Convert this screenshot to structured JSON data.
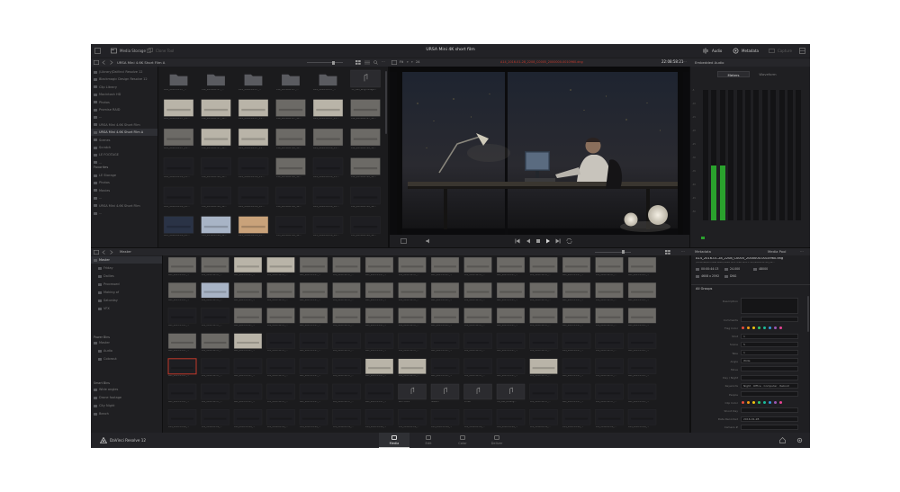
{
  "topbar": {
    "media_storage": "Media Storage",
    "clone_tool": "Clone Tool",
    "project_title": "URSA Mini 4K short film",
    "audio": "Audio",
    "metadata": "Metadata",
    "capture": "Capture"
  },
  "browser": {
    "path": "URSA Mini 4.6K Short Film A",
    "items": [
      {
        "label": "(Library)DaVinci Resolve 12"
      },
      {
        "label": "Blackmagic Design Resolve 12"
      },
      {
        "label": "Clip Library"
      },
      {
        "label": "Macintosh HD"
      },
      {
        "label": "Photos"
      },
      {
        "label": "Promise RAID"
      },
      {
        "label": "..."
      },
      {
        "label": "URSA Mini 4.6K Short Film"
      },
      {
        "label": "URSA Mini 4.6K Short Film A"
      },
      {
        "label": "Scenes"
      },
      {
        "label": "Scratch"
      },
      {
        "label": "LE FOOTAGE"
      },
      {
        "label": "..."
      }
    ],
    "selected_index": 8,
    "favorites_title": "Favorites",
    "favorites": [
      {
        "label": "LE Storage"
      },
      {
        "label": "Photos"
      },
      {
        "label": "Movies"
      },
      {
        "label": "..."
      },
      {
        "label": "URSA Mini 4.6K Short Film"
      },
      {
        "label": "..."
      }
    ]
  },
  "media_grid": {
    "clips": [
      {
        "name": "A14_2016-01-27_...",
        "tone": "folder"
      },
      {
        "name": "A14_2016-01-27_...",
        "tone": "folder"
      },
      {
        "name": "A14_2016-01-27_...",
        "tone": "folder"
      },
      {
        "name": "A14_2016-01-27_...",
        "tone": "folder"
      },
      {
        "name": "A14_2016-01-27_...",
        "tone": "folder"
      },
      {
        "name": "ITA_Cell_ertgminage...",
        "tone": "audio"
      },
      {
        "name": "A14_2016-01-27_11...",
        "tone": "light"
      },
      {
        "name": "A14_2016-01-27_11...",
        "tone": "light"
      },
      {
        "name": "A14_2016-01-27_11...",
        "tone": "light"
      },
      {
        "name": "A14_2016-01-27_11...",
        "tone": "mid"
      },
      {
        "name": "A14_2016-01-27_11...",
        "tone": "light"
      },
      {
        "name": "A14_2016-01-27_11...",
        "tone": "mid"
      },
      {
        "name": "A14_2016-01-27_11...",
        "tone": "mid"
      },
      {
        "name": "A14_2016-01-27_11...",
        "tone": "light"
      },
      {
        "name": "A14_2016-01-27_11...",
        "tone": "light"
      },
      {
        "name": "A14_2016-01-28_11...",
        "tone": "mid"
      },
      {
        "name": "A14_2016-01-28_11...",
        "tone": "mid"
      },
      {
        "name": "A14_2016-01-28_11...",
        "tone": "mid"
      },
      {
        "name": "A14_2016-01-28_11...",
        "tone": "dark"
      },
      {
        "name": "A14_2016-01-28_11...",
        "tone": "dark"
      },
      {
        "name": "A14_2016-01-28_11...",
        "tone": "dark"
      },
      {
        "name": "A14_2016-01-28_11...",
        "tone": "mid"
      },
      {
        "name": "A14_2016-01-28_11...",
        "tone": "dark"
      },
      {
        "name": "A14_2016-01-28_11...",
        "tone": "mid"
      },
      {
        "name": "A14_2016-01-28_12...",
        "tone": "dark"
      },
      {
        "name": "A14_2016-01-28_12...",
        "tone": "dark"
      },
      {
        "name": "A14_2016-01-28_12...",
        "tone": "dark"
      },
      {
        "name": "A14_2016-01-28_12...",
        "tone": "dark"
      },
      {
        "name": "A14_2016-01-28_12...",
        "tone": "dark"
      },
      {
        "name": "A14_2016-01-28_12...",
        "tone": "dark"
      },
      {
        "name": "A15_2016-01-28_12...",
        "tone": "blue"
      },
      {
        "name": "C15_2016-01-28_12...",
        "tone": "sky"
      },
      {
        "name": "C15_2016-01-28_12...",
        "tone": "warm"
      },
      {
        "name": "A15_2016-01-28_12...",
        "tone": "dark"
      },
      {
        "name": "A15_2016-01-28_12...",
        "tone": "dark"
      },
      {
        "name": "A15_2016-01-28_12...",
        "tone": "dark"
      }
    ]
  },
  "viewer": {
    "fit": "Fit",
    "zoom": "24",
    "clip_name": "A14_2016-01-28_2208_C0005_2000000-0010960.dng",
    "timecode": "22:08:58:21"
  },
  "audio_panel": {
    "title": "Embedded Audio",
    "tab_meters": "Meters",
    "tab_waveform": "Waveform",
    "meter_levels": [
      0,
      0.42,
      0.42,
      0,
      0,
      0,
      0,
      0,
      0,
      0,
      0,
      0
    ],
    "scale_labels": [
      "-5",
      "-10",
      "-15",
      "-20",
      "-25",
      "-30",
      "-35",
      "-40",
      "-45",
      "-50"
    ]
  },
  "pool": {
    "title": "Master",
    "bins": [
      {
        "label": "Master",
        "level": 0
      },
      {
        "label": "Friday",
        "level": 1
      },
      {
        "label": "Dailies",
        "level": 1
      },
      {
        "label": "Processed",
        "level": 1
      },
      {
        "label": "Making of",
        "level": 1
      },
      {
        "label": "Saturday",
        "level": 1
      },
      {
        "label": "VFX",
        "level": 1
      }
    ],
    "power_bins_title": "Power Bins",
    "power_bins": [
      {
        "label": "Master",
        "level": 0
      },
      {
        "label": "Audio",
        "level": 1
      },
      {
        "label": "Colorout",
        "level": 1
      }
    ],
    "smart_bins_title": "Smart Bins",
    "smart_bins": [
      {
        "label": "Wide angles"
      },
      {
        "label": "Drone footage"
      },
      {
        "label": "City Night"
      },
      {
        "label": "Beach"
      }
    ],
    "selected_clip": 60,
    "clips": [
      {
        "name": "A01_2015-11-17_...",
        "tone": "mid"
      },
      {
        "name": "A01_2015-11-17_...",
        "tone": "mid"
      },
      {
        "name": "A01_2015-11-17_...",
        "tone": "light"
      },
      {
        "name": "A01_2015-11-17_...",
        "tone": "light"
      },
      {
        "name": "A01_2015-11-17_...",
        "tone": "mid"
      },
      {
        "name": "A01_2015-11-17_...",
        "tone": "mid"
      },
      {
        "name": "A01_2015-11-17_...",
        "tone": "mid"
      },
      {
        "name": "A01_2015-11-17_...",
        "tone": "mid"
      },
      {
        "name": "A01_2015-11-17_...",
        "tone": "mid"
      },
      {
        "name": "A01_2015-11-17_...",
        "tone": "mid"
      },
      {
        "name": "A01_2015-11-17_...",
        "tone": "mid"
      },
      {
        "name": "A01_2015-11-17_...",
        "tone": "mid"
      },
      {
        "name": "A01_2015-11-17_...",
        "tone": "mid"
      },
      {
        "name": "A01_2015-11-17_...",
        "tone": "mid"
      },
      {
        "name": "A01_2015-11-17_...",
        "tone": "mid"
      },
      {
        "name": "A01_2015-11-17_...",
        "tone": "mid"
      },
      {
        "name": "A01_2015-11-17_...",
        "tone": "sky"
      },
      {
        "name": "A01_2015-11-17_...",
        "tone": "mid"
      },
      {
        "name": "A01_2015-11-17_...",
        "tone": "mid"
      },
      {
        "name": "A01_2015-11-17_...",
        "tone": "mid"
      },
      {
        "name": "A01_2015-11-17_...",
        "tone": "mid"
      },
      {
        "name": "A01_2015-11-17_...",
        "tone": "mid"
      },
      {
        "name": "A01_2015-11-17_...",
        "tone": "mid"
      },
      {
        "name": "A01_2015-11-17_...",
        "tone": "mid"
      },
      {
        "name": "A01_2015-11-17_...",
        "tone": "mid"
      },
      {
        "name": "A01_2015-11-17_...",
        "tone": "mid"
      },
      {
        "name": "A01_2015-11-17_...",
        "tone": "mid"
      },
      {
        "name": "A01_2015-11-17_...",
        "tone": "mid"
      },
      {
        "name": "A01_2015-11-17_...",
        "tone": "mid"
      },
      {
        "name": "A01_2015-11-17_...",
        "tone": "mid"
      },
      {
        "name": "A01_2015-11-17_...",
        "tone": "dark"
      },
      {
        "name": "A01_2015-11-17_...",
        "tone": "dark"
      },
      {
        "name": "A01_2015-11-17_...",
        "tone": "mid"
      },
      {
        "name": "A01_2015-11-17_...",
        "tone": "mid"
      },
      {
        "name": "A01_2015-11-17_...",
        "tone": "mid"
      },
      {
        "name": "A01_2015-11-17_...",
        "tone": "mid"
      },
      {
        "name": "A01_2015-11-17_...",
        "tone": "mid"
      },
      {
        "name": "A01_2015-11-17_...",
        "tone": "mid"
      },
      {
        "name": "A01_2015-11-17_...",
        "tone": "mid"
      },
      {
        "name": "A01_2015-11-17_...",
        "tone": "mid"
      },
      {
        "name": "A01_2015-11-17_...",
        "tone": "mid"
      },
      {
        "name": "A01_2015-11-17_...",
        "tone": "mid"
      },
      {
        "name": "A01_2015-11-17_...",
        "tone": "mid"
      },
      {
        "name": "A01_2015-11-17_...",
        "tone": "mid"
      },
      {
        "name": "A01_2015-11-17_...",
        "tone": "mid"
      },
      {
        "name": "A01_2015-11-17_...",
        "tone": "mid"
      },
      {
        "name": "A01_2015-11-17_...",
        "tone": "mid"
      },
      {
        "name": "A01_2015-11-27_...",
        "tone": "light"
      },
      {
        "name": "A01_2015-11-17_...",
        "tone": "dark"
      },
      {
        "name": "A01_2015-11-17_...",
        "tone": "dark"
      },
      {
        "name": "A01_2015-11-17_...",
        "tone": "dark"
      },
      {
        "name": "A01_2015-11-17_...",
        "tone": "dark"
      },
      {
        "name": "A01_2015-11-17_...",
        "tone": "dark"
      },
      {
        "name": "A01_2015-11-17_...",
        "tone": "dark"
      },
      {
        "name": "A01_2015-11-17_...",
        "tone": "dark"
      },
      {
        "name": "A01_2015-11-17_...",
        "tone": "dark"
      },
      {
        "name": "A01_2015-11-17_...",
        "tone": "dark"
      },
      {
        "name": "A14_2016-01-27_...",
        "tone": "dark"
      },
      {
        "name": "A01_2015-11-17_...",
        "tone": "dark"
      },
      {
        "name": "A01_2015-11-17_...",
        "tone": "dark"
      },
      {
        "name": "A01_2015-11-17_...",
        "tone": "dark"
      },
      {
        "name": "A01_2015-11-17_...",
        "tone": "dark"
      },
      {
        "name": "A01_2015-11-17_...",
        "tone": "dark"
      },
      {
        "name": "A01_2015-11-17_...",
        "tone": "dark"
      },
      {
        "name": "A01_2015-11-17_...",
        "tone": "dark"
      },
      {
        "name": "A01_2015-11-17_...",
        "tone": "dark"
      },
      {
        "name": "A01_2015-11-17_...",
        "tone": "light"
      },
      {
        "name": "A01_2015-11-17_...",
        "tone": "light"
      },
      {
        "name": "A01_2015-11-17_...",
        "tone": "dark"
      },
      {
        "name": "A01_2015-11-17_...",
        "tone": "dark"
      },
      {
        "name": "A01_2015-11-17_...",
        "tone": "dark"
      },
      {
        "name": "A01_2015-11-17_...",
        "tone": "light"
      },
      {
        "name": "A01_2015-11-17_...",
        "tone": "dark"
      },
      {
        "name": "A01_2015-11-17_...",
        "tone": "dark"
      },
      {
        "name": "A01_2015-11-17_...",
        "tone": "dark"
      },
      {
        "name": "A01_2015-11-17_...",
        "tone": "dark"
      },
      {
        "name": "A01_2015-11-17_...",
        "tone": "dark"
      },
      {
        "name": "A01_2015-11-17_...",
        "tone": "dark"
      },
      {
        "name": "A01_2015-11-17_...",
        "tone": "dark"
      },
      {
        "name": "A01_2015-11-17_...",
        "tone": "dark"
      },
      {
        "name": "A01_2015-11-17_...",
        "tone": "dark"
      },
      {
        "name": "A01_2015-11-17_...",
        "tone": "dark"
      },
      {
        "name": "Tech Clock",
        "tone": "audio"
      },
      {
        "name": "Station",
        "tone": "audio"
      },
      {
        "name": "Arrive",
        "tone": "audio"
      },
      {
        "name": "ITA_Cell_Rinsing...",
        "tone": "audio"
      },
      {
        "name": "A01_2015-11-17_...",
        "tone": "dark"
      },
      {
        "name": "A01_2015-11-17_...",
        "tone": "dark"
      },
      {
        "name": "A01_2015-11-17_...",
        "tone": "dark"
      },
      {
        "name": "A01_2015-11-17_...",
        "tone": "dark"
      },
      {
        "name": "A14_2016-01-28_...",
        "tone": "dark"
      },
      {
        "name": "A14_2016-01-28_...",
        "tone": "dark"
      },
      {
        "name": "A14_2016-01-28_...",
        "tone": "dark"
      },
      {
        "name": "A14_2016-01-28_...",
        "tone": "dark"
      },
      {
        "name": "A14_2016-01-28_...",
        "tone": "dark"
      },
      {
        "name": "A14_2016-01-28_...",
        "tone": "dark"
      },
      {
        "name": "A14_2016-01-28_...",
        "tone": "dark"
      },
      {
        "name": "A14_2016-01-28_...",
        "tone": "dark"
      },
      {
        "name": "A14_2016-01-28_...",
        "tone": "dark"
      },
      {
        "name": "A14_2016-01-28_...",
        "tone": "dark"
      },
      {
        "name": "A14_2016-01-28_...",
        "tone": "dark"
      },
      {
        "name": "A14_2016-01-28_...",
        "tone": "dark"
      },
      {
        "name": "A14_2016-01-28_...",
        "tone": "dark"
      },
      {
        "name": "A14_2016-01-28_...",
        "tone": "dark"
      },
      {
        "name": "A14_2016-01-28_...",
        "tone": "dark"
      }
    ]
  },
  "metadata": {
    "title": "Metadata",
    "media_pool": "Media Pool",
    "clip_name": "A14_2016-01-28_2208_C0005_2000000-0010960.dng",
    "clip_path": "/Volumes/Promise RAID/URSA Mini 4.6K Short Film/2016-01-28_22...",
    "specs": [
      {
        "icon": "clock",
        "value": "00:00:44:13"
      },
      {
        "icon": "fps",
        "value": "24.000"
      },
      {
        "icon": "audio",
        "value": "48000"
      },
      {
        "icon": "res",
        "value": "4608 x 2592"
      },
      {
        "icon": "codec",
        "value": "DNG"
      }
    ],
    "group_title": "All Groups",
    "fields": [
      {
        "label": "Description",
        "value": "",
        "tall": true
      },
      {
        "label": "Comments",
        "value": ""
      },
      {
        "label": "Flag Color",
        "value": "",
        "dots": true
      },
      {
        "label": "Shot",
        "value": "1"
      },
      {
        "label": "Scene",
        "value": "5"
      },
      {
        "label": "Take",
        "value": "1"
      },
      {
        "label": "Angle",
        "value": "Wide"
      },
      {
        "label": "Move",
        "value": ""
      },
      {
        "label": "Day / Night",
        "value": ""
      },
      {
        "label": "Keywords",
        "value": "Night · Office · Computer · Reboot"
      },
      {
        "label": "People",
        "value": ""
      },
      {
        "label": "Clip Color",
        "value": "",
        "dots": true
      },
      {
        "label": "Shoot Day",
        "value": ""
      },
      {
        "label": "Date Recorded",
        "value": "2016-01-28"
      },
      {
        "label": "Camera #",
        "value": ""
      }
    ]
  },
  "bottombar": {
    "app_name": "DaVinci Resolve 12",
    "pages": [
      {
        "label": "Media"
      },
      {
        "label": "Edit"
      },
      {
        "label": "Color"
      },
      {
        "label": "Deliver"
      }
    ],
    "active_page": 0
  },
  "colors": {
    "app_bg": "#1c1c1e",
    "panel_bg": "#1f1f22",
    "accent_red": "#c0392b",
    "meter_green": "#2aa22d"
  }
}
